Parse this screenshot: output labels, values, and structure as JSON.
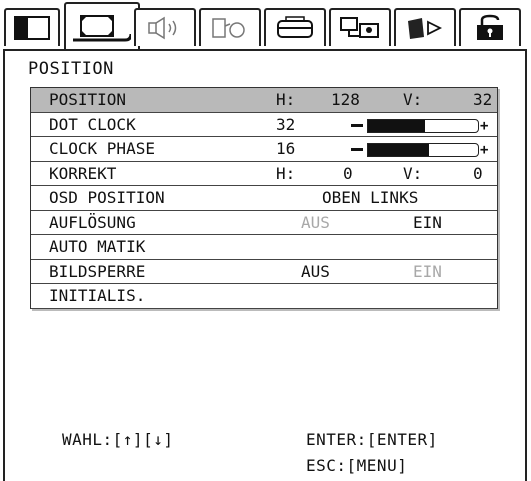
{
  "tabs": [
    {
      "icon": "display-icon",
      "active": false
    },
    {
      "icon": "position-arrows-icon",
      "active": true
    },
    {
      "icon": "speaker-icon",
      "active": false
    },
    {
      "icon": "input-source-icon",
      "active": false
    },
    {
      "icon": "projector-icon",
      "active": false
    },
    {
      "icon": "network-icon",
      "active": false
    },
    {
      "icon": "play-media-icon",
      "active": false
    },
    {
      "icon": "lock-icon",
      "active": false
    }
  ],
  "panel": {
    "title": "POSITION"
  },
  "menu": {
    "position": {
      "label": "POSITION",
      "h_label": "H:",
      "h_value": "128",
      "v_label": "V:",
      "v_value": "32"
    },
    "dot_clock": {
      "label": "DOT CLOCK",
      "value": "32",
      "level": 0.52
    },
    "clock_phase": {
      "label": "CLOCK PHASE",
      "value": "16",
      "level": 0.55
    },
    "korrekt": {
      "label": "KORREKT",
      "h_label": "H:",
      "h_value": "0",
      "v_label": "V:",
      "v_value": "0"
    },
    "osd_position": {
      "label": "OSD POSITION",
      "value": "OBEN LINKS"
    },
    "aufloesung": {
      "label": "AUFLÖSUNG",
      "off": "AUS",
      "on": "EIN",
      "selected": "EIN"
    },
    "automatik": {
      "label": "AUTO MATIK"
    },
    "bildsperre": {
      "label": "BILDSPERRE",
      "off": "AUS",
      "on": "EIN",
      "selected": "AUS"
    },
    "initialis": {
      "label": "INITIALIS."
    }
  },
  "footer": {
    "wahl": "WAHL:[↑][↓]",
    "enter": "ENTER:[ENTER]",
    "esc": "ESC:[MENU]"
  },
  "colors": {
    "selected_row": "#b9b9b9",
    "muted_text": "#a8a8a8",
    "border": "#222222"
  }
}
